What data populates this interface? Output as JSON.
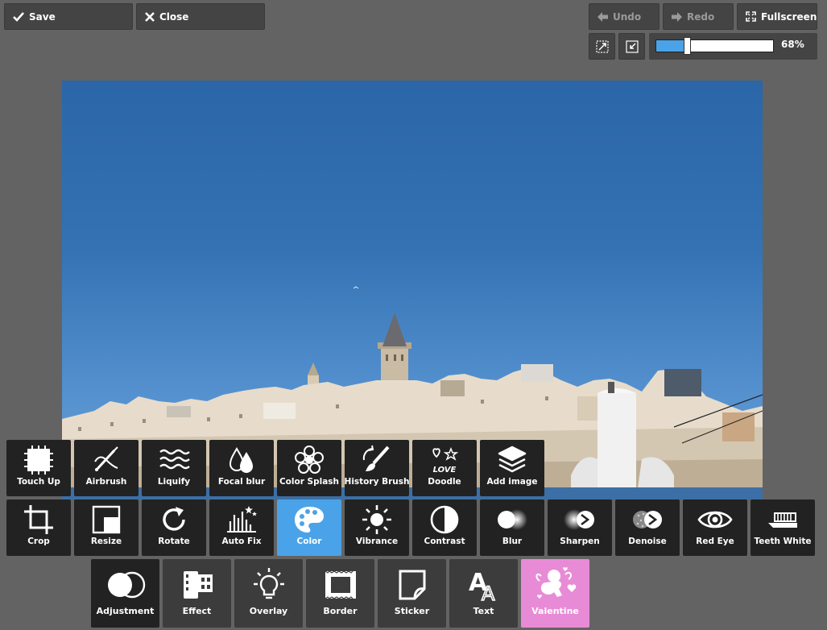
{
  "toolbar": {
    "save_label": "Save",
    "close_label": "Close",
    "undo_label": "Undo",
    "redo_label": "Redo",
    "fullscreen_label": "Fullscreen"
  },
  "zoom": {
    "value_label": "68%",
    "level": 0.26
  },
  "tools_row1": [
    {
      "label": "Touch Up",
      "icon": "touch-up-icon"
    },
    {
      "label": "Airbrush",
      "icon": "airbrush-icon"
    },
    {
      "label": "Liquify",
      "icon": "liquify-icon"
    },
    {
      "label": "Focal blur",
      "icon": "focal-blur-icon"
    },
    {
      "label": "Color Splash",
      "icon": "color-splash-icon"
    },
    {
      "label": "History Brush",
      "icon": "history-brush-icon"
    },
    {
      "label": "Doodle",
      "icon": "doodle-icon"
    },
    {
      "label": "Add image",
      "icon": "add-image-icon"
    }
  ],
  "tools_row2": [
    {
      "label": "Crop",
      "icon": "crop-icon"
    },
    {
      "label": "Resize",
      "icon": "resize-icon"
    },
    {
      "label": "Rotate",
      "icon": "rotate-icon"
    },
    {
      "label": "Auto Fix",
      "icon": "auto-fix-icon"
    },
    {
      "label": "Color",
      "icon": "palette-icon",
      "active": true
    },
    {
      "label": "Vibrance",
      "icon": "sun-icon"
    },
    {
      "label": "Contrast",
      "icon": "contrast-icon"
    },
    {
      "label": "Blur",
      "icon": "blur-icon"
    },
    {
      "label": "Sharpen",
      "icon": "sharpen-icon"
    },
    {
      "label": "Denoise",
      "icon": "denoise-icon"
    },
    {
      "label": "Red Eye",
      "icon": "eye-icon"
    },
    {
      "label": "Teeth White",
      "icon": "toothbrush-icon"
    }
  ],
  "categories": [
    {
      "label": "Adjustment",
      "icon": "adjustment-icon"
    },
    {
      "label": "Effect",
      "icon": "film-icon"
    },
    {
      "label": "Overlay",
      "icon": "light-bulb-icon"
    },
    {
      "label": "Border",
      "icon": "border-frame-icon"
    },
    {
      "label": "Sticker",
      "icon": "sticker-icon"
    },
    {
      "label": "Text",
      "icon": "text-icon"
    },
    {
      "label": "Valentine",
      "icon": "cupid-icon"
    }
  ],
  "colors": {
    "accent": "#4aa3e8",
    "valentine": "#e88bd6"
  }
}
